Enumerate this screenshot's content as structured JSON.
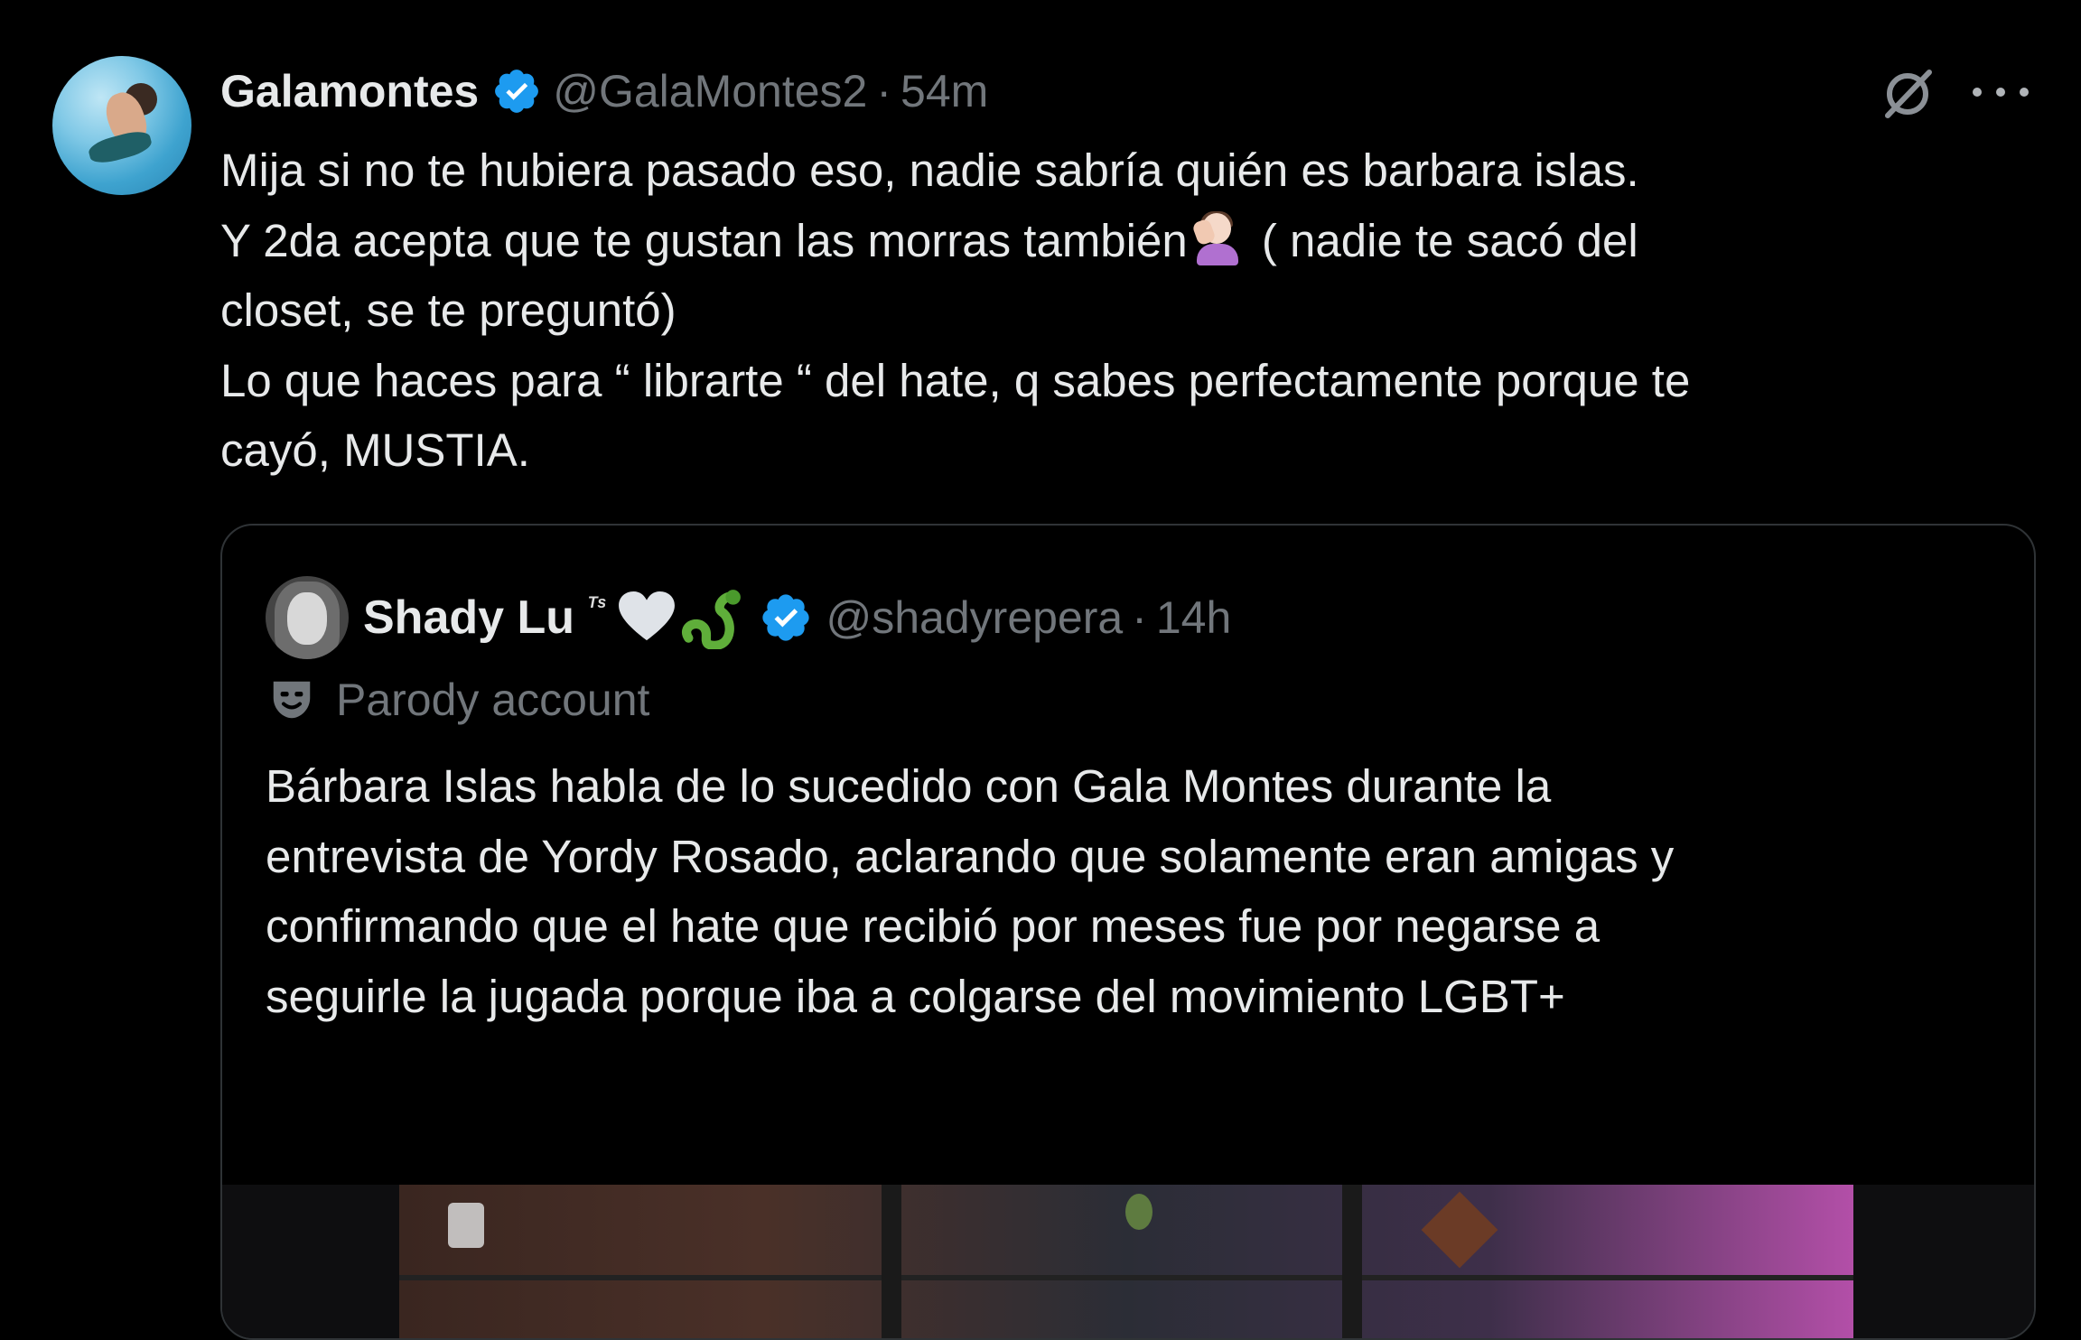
{
  "tweet": {
    "author_name": "Galamontes",
    "author_handle": "@GalaMontes2",
    "separator": "·",
    "time": "54m",
    "lines": [
      "Mija si no te hubiera pasado eso, nadie sabría quién es barbara islas.",
      "Y 2da  acepta  que te gustan las morras también",
      "( nadie te sacó del",
      "closet, se te preguntó)",
      "Lo que haces para “ librarte  “ del hate, q sabes perfectamente  porque te",
      "cayó, MUSTIA."
    ],
    "icons": {
      "verified": "verified-badge-icon",
      "grok": "grok-icon",
      "more": "more-icon",
      "emoji": "woman-facepalming-icon"
    }
  },
  "quoted_tweet": {
    "author_name": "Shady Lu",
    "name_suffix": "ᵀˢ",
    "author_handle": "@shadyrepera",
    "separator": "·",
    "time": "14h",
    "label": "Parody account",
    "lines": [
      "Bárbara Islas habla de lo sucedido con Gala Montes durante la",
      "entrevista de Yordy Rosado, aclarando que solamente eran amigas y",
      "confirmando que el hate que recibió por meses fue por negarse a",
      "seguirle la jugada porque iba a colgarse del movimiento LGBT+"
    ],
    "icons": {
      "heart": "white-heart-icon",
      "snake": "snake-icon",
      "verified": "verified-badge-icon",
      "parody": "theater-mask-icon"
    }
  },
  "colors": {
    "background": "#000000",
    "text_primary": "#e7e9ea",
    "text_secondary": "#71767b",
    "verified_blue": "#1d9bf0",
    "border": "#2f3336"
  }
}
